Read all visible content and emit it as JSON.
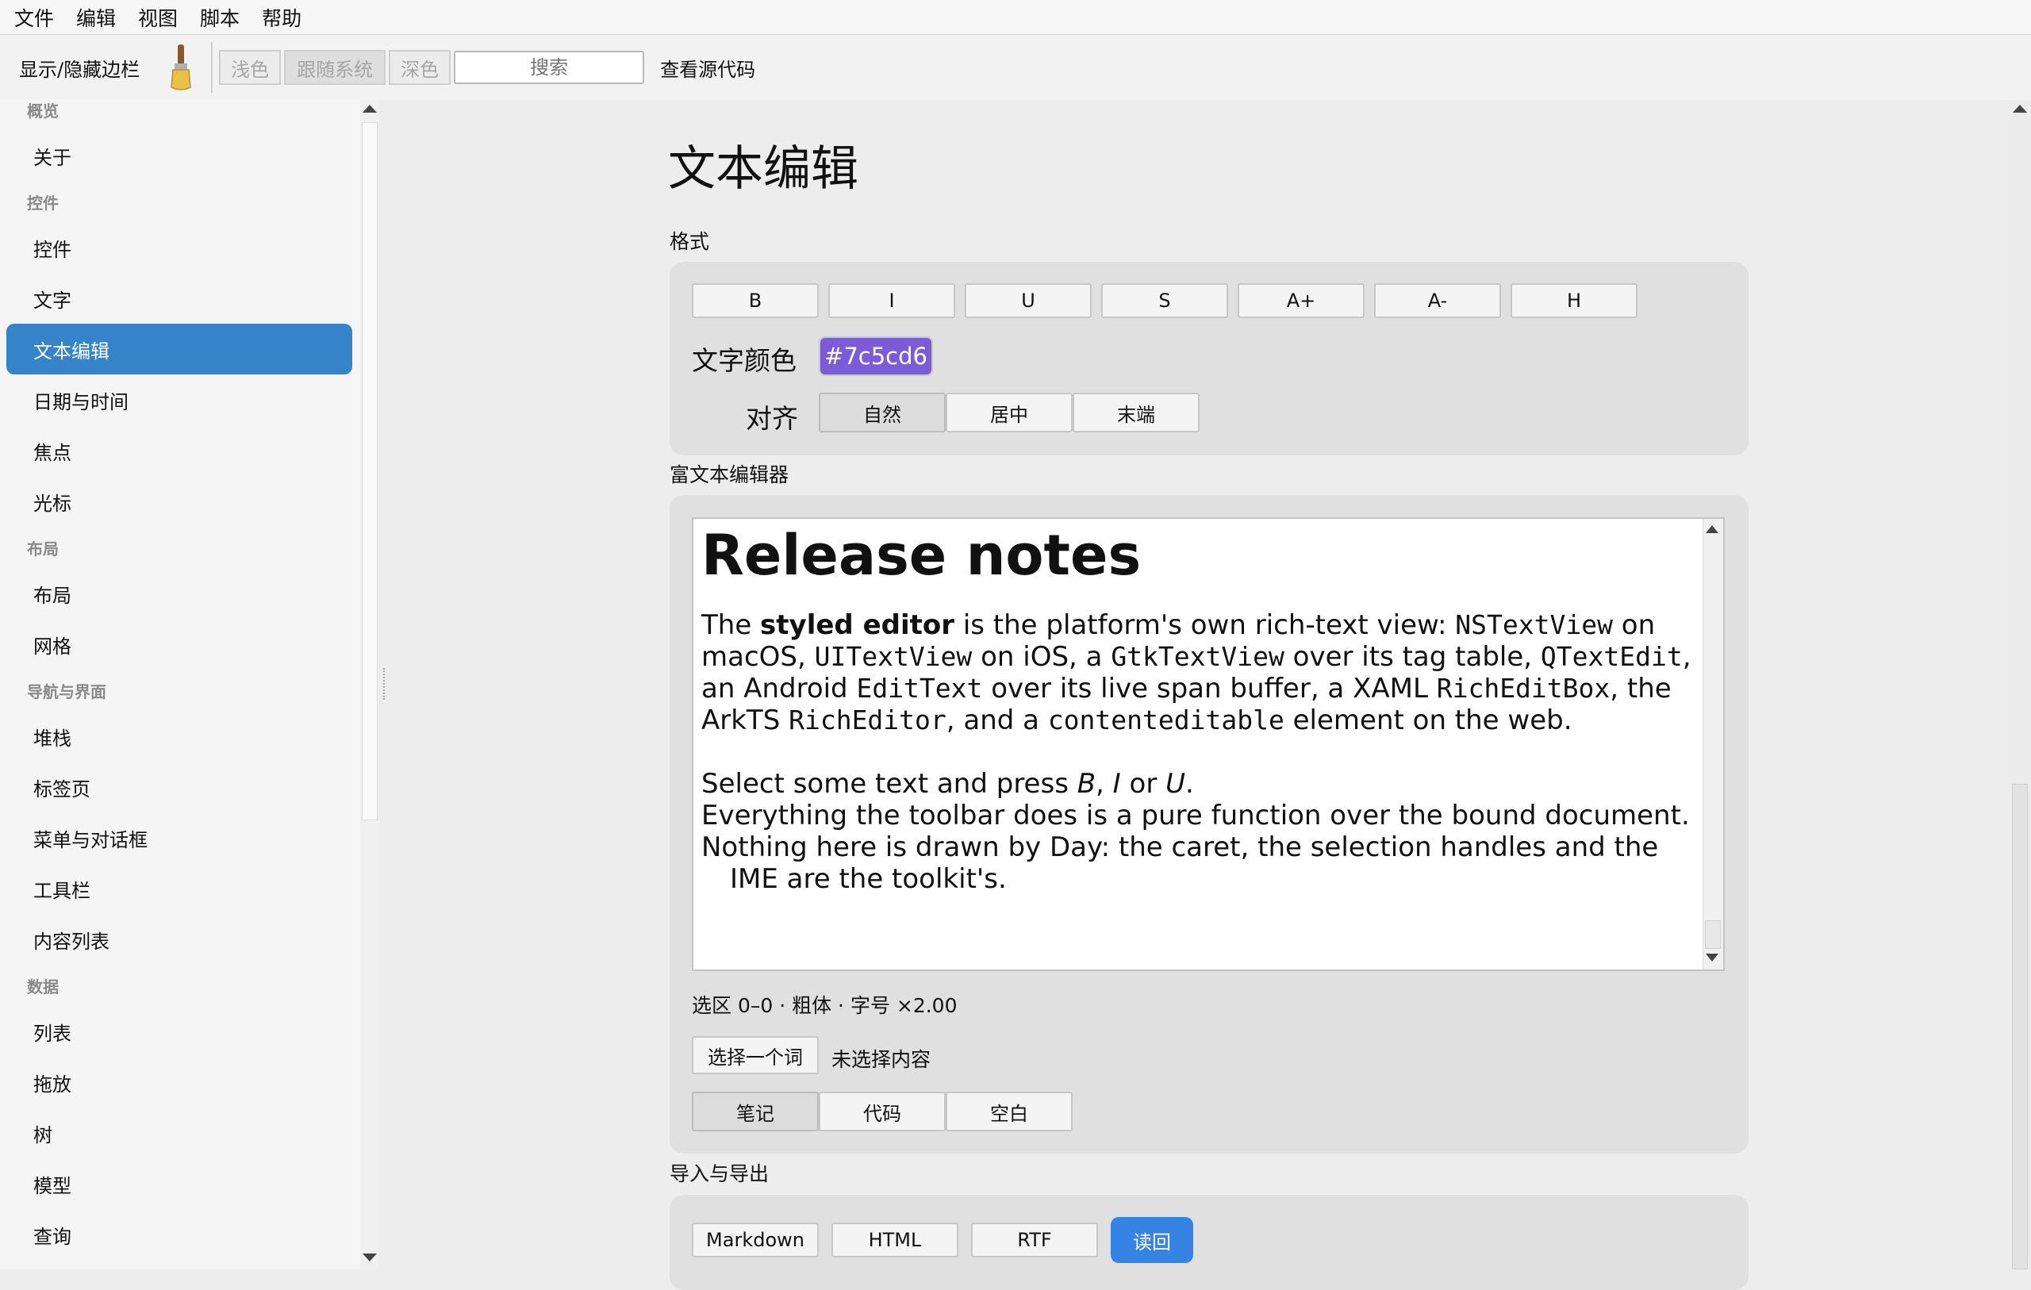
{
  "menu": [
    "文件",
    "编辑",
    "视图",
    "脚本",
    "帮助"
  ],
  "toolbar": {
    "toggle_sidebar": "显示/隐藏边栏",
    "theme": [
      "浅色",
      "跟随系统",
      "深色"
    ],
    "search_placeholder": "搜索",
    "view_source": "查看源代码"
  },
  "sidebar": {
    "sections": [
      {
        "title": "概览",
        "items": [
          "关于"
        ]
      },
      {
        "title": "控件",
        "items": [
          "控件",
          "文字",
          "文本编辑",
          "日期与时间",
          "焦点",
          "光标"
        ]
      },
      {
        "title": "布局",
        "items": [
          "布局",
          "网格"
        ]
      },
      {
        "title": "导航与界面",
        "items": [
          "堆栈",
          "标签页",
          "菜单与对话框",
          "工具栏",
          "内容列表"
        ]
      },
      {
        "title": "数据",
        "items": [
          "列表",
          "拖放",
          "树",
          "模型",
          "查询"
        ]
      }
    ],
    "active": "文本编辑"
  },
  "page": {
    "title": "文本编辑",
    "format_label": "格式",
    "format_buttons": [
      "B",
      "I",
      "U",
      "S",
      "A+",
      "A-",
      "H"
    ],
    "text_color_label": "文字颜色",
    "text_color_value": "#7c5cd6",
    "align_label": "对齐",
    "align_options": [
      "自然",
      "居中",
      "末端"
    ],
    "align_selected": "自然",
    "rich_editor_label": "富文本编辑器",
    "editor": {
      "heading": "Release notes",
      "p1": {
        "a": "The ",
        "b": "styled editor",
        "c": " is the platform's own rich-text view: ",
        "m1": "NSTextView",
        "d": " on macOS, ",
        "m2": "UITextView",
        "e": " on iOS, a ",
        "m3": "GtkTextView",
        "f": " over its tag table, ",
        "m4": "QTextEdit",
        "g": ", an Android ",
        "m5": "EditText",
        "h": " over its live span buffer, a XAML ",
        "m6": "RichEditBox",
        "i": ", the ArkTS ",
        "m7": "RichEditor",
        "j": ", and a ",
        "m8": "contenteditable",
        "k": " element on the web."
      },
      "p2": {
        "a": "Select some text and press ",
        "b": "B",
        "c": ", ",
        "d": "I",
        "e": " or ",
        "f": "U",
        "g": "."
      },
      "p3": "Everything the toolbar does is a pure function over the bound document.",
      "p4a": "Nothing here is drawn by Day: the caret, the selection handles and the",
      "p4b": "IME are the toolkit's."
    },
    "status": "选区 0–0 · 粗体 · 字号 ×2.00",
    "select_word_button": "选择一个词",
    "no_selection": "未选择内容",
    "mode_options": [
      "笔记",
      "代码",
      "空白"
    ],
    "mode_selected": "笔记",
    "import_export_label": "导入与导出",
    "export_buttons": [
      "Markdown",
      "HTML",
      "RTF"
    ],
    "read_back_button": "读回",
    "accent_color": "#3584e4",
    "sidebar_active_color": "#3584c9"
  }
}
